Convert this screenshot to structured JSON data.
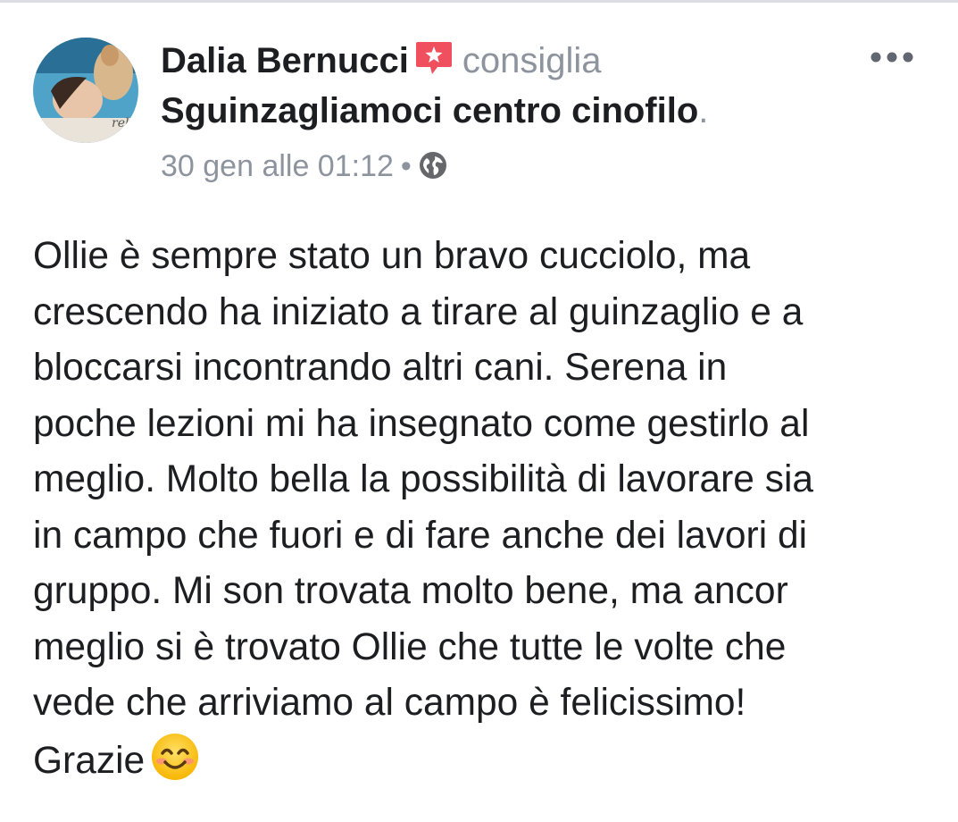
{
  "post": {
    "author": "Dalia Bernucci",
    "verb": "consiglia",
    "page_name": "Sguinzagliamoci centro cinofilo",
    "period": ".",
    "timestamp": "30 gen alle 01:12",
    "separator": "•",
    "audience_icon": "globe-icon",
    "recommend_icon": "star-recommend-icon",
    "more_icon": "ellipsis-icon",
    "body_lines": [
      "Ollie è sempre stato un bravo cucciolo, ma",
      "crescendo ha iniziato a tirare al guinzaglio e a",
      "bloccarsi incontrando altri cani. Serena in",
      "poche lezioni mi ha insegnato come gestirlo al",
      "meglio. Molto bella la possibilità di lavorare sia",
      "in campo che fuori e di fare anche dei lavori di",
      "gruppo. Mi son trovata molto bene, ma ancor",
      "meglio si è trovato Ollie che tutte le volte che",
      "vede che arriviamo al campo è felicissimo!"
    ],
    "closing": "Grazie",
    "closing_emoji": "smiling-face-icon"
  },
  "colors": {
    "recommend_accent": "#f0505e",
    "secondary_text": "#8d949e",
    "primary_text": "#1c1e21"
  }
}
